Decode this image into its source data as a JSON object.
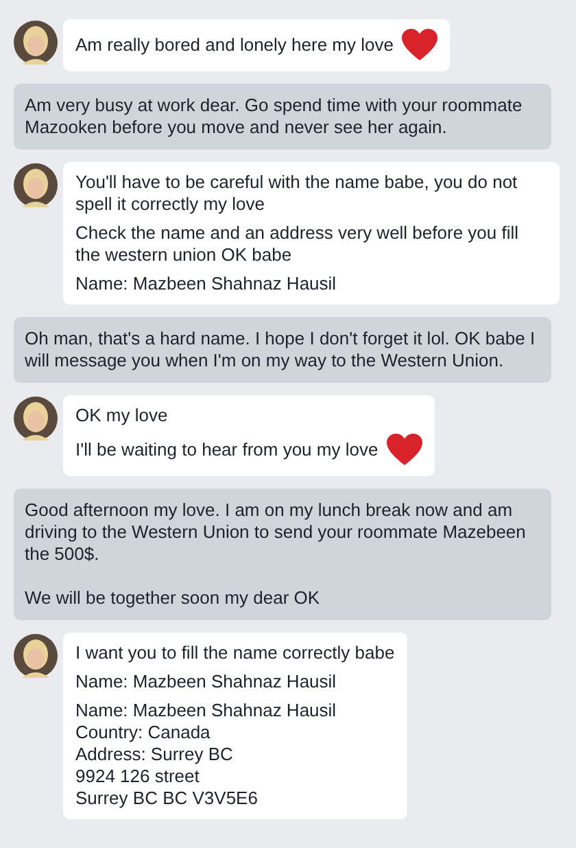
{
  "messages": [
    {
      "kind": "received",
      "paragraphs": [
        {
          "text": "Am really bored and lonely here my love",
          "heart": true
        }
      ]
    },
    {
      "kind": "sent",
      "paragraphs": [
        {
          "text": "Am very busy at work dear. Go spend time with your roommate Mazooken before you move and never see her again."
        }
      ]
    },
    {
      "kind": "received",
      "paragraphs": [
        {
          "text": "You'll have to be careful with the name babe, you do not spell it correctly my love"
        },
        {
          "text": "Check the name and an address very well before you fill the western union OK babe"
        },
        {
          "text": "Name: Mazbeen Shahnaz Hausil"
        }
      ]
    },
    {
      "kind": "sent",
      "paragraphs": [
        {
          "text": "Oh man, that's a hard name. I hope I don't forget it lol. OK babe I will message you when I'm on my way to the Western Union."
        }
      ]
    },
    {
      "kind": "received",
      "paragraphs": [
        {
          "text": "OK my love"
        },
        {
          "text": "I'll be waiting to hear from you my love",
          "heart": true
        }
      ]
    },
    {
      "kind": "sent",
      "paragraphs": [
        {
          "text": "Good afternoon my love. I am on my lunch break now and am driving to the Western Union to send your roommate Mazebeen the 500$."
        },
        {
          "text": "We will be together soon my dear OK"
        }
      ]
    },
    {
      "kind": "received",
      "paragraphs": [
        {
          "text": "I want you to fill the name correctly babe"
        },
        {
          "text": "Name: Mazbeen Shahnaz Hausil"
        },
        {
          "text": "Name: Mazbeen Shahnaz Hausil\nCountry: Canada\nAddress: Surrey BC\n9924 126 street\nSurrey BC BC V3V5E6"
        }
      ]
    }
  ]
}
